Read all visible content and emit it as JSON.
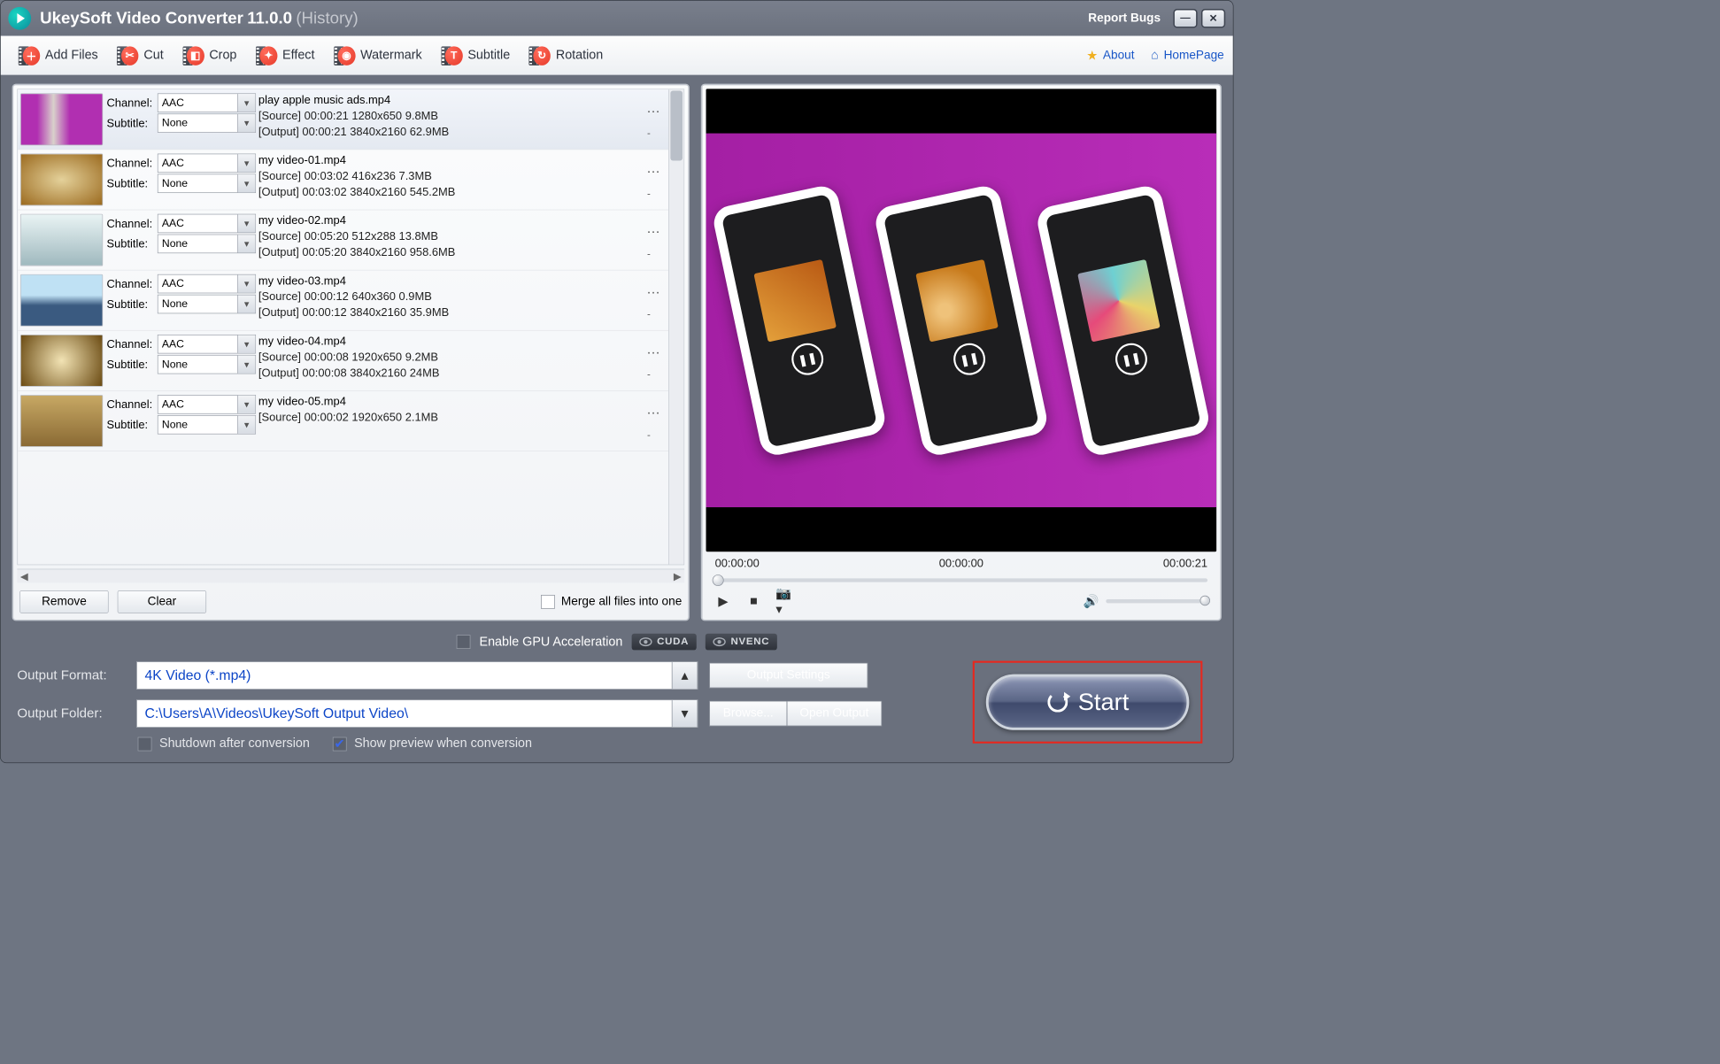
{
  "title": {
    "app": "UkeySoft Video Converter",
    "version": "11.0.0",
    "history": "(History)",
    "report": "Report Bugs"
  },
  "toolbar": {
    "add": "Add Files",
    "cut": "Cut",
    "crop": "Crop",
    "effect": "Effect",
    "watermark": "Watermark",
    "subtitle": "Subtitle",
    "rotation": "Rotation",
    "about": "About",
    "homepage": "HomePage"
  },
  "labels": {
    "channel": "Channel:",
    "subtitle": "Subtitle:",
    "merge": "Merge all files into one",
    "remove": "Remove",
    "clear": "Clear"
  },
  "items": [
    {
      "file": "play apple music ads.mp4",
      "channel": "AAC",
      "subtitle": "None",
      "src": "[Source]  00:00:21  1280x650  9.8MB",
      "out": "[Output]  00:00:21  3840x2160  62.9MB"
    },
    {
      "file": "my video-01.mp4",
      "channel": "AAC",
      "subtitle": "None",
      "src": "[Source]  00:03:02  416x236  7.3MB",
      "out": "[Output]  00:03:02  3840x2160  545.2MB"
    },
    {
      "file": "my video-02.mp4",
      "channel": "AAC",
      "subtitle": "None",
      "src": "[Source]  00:05:20  512x288  13.8MB",
      "out": "[Output]  00:05:20  3840x2160  958.6MB"
    },
    {
      "file": "my video-03.mp4",
      "channel": "AAC",
      "subtitle": "None",
      "src": "[Source]  00:00:12  640x360  0.9MB",
      "out": "[Output]  00:00:12  3840x2160  35.9MB"
    },
    {
      "file": "my video-04.mp4",
      "channel": "AAC",
      "subtitle": "None",
      "src": "[Source]  00:00:08  1920x650  9.2MB",
      "out": "[Output]  00:00:08  3840x2160  24MB"
    },
    {
      "file": "my video-05.mp4",
      "channel": "AAC",
      "subtitle": "None",
      "src": "[Source]  00:00:02  1920x650  2.1MB",
      "out": ""
    }
  ],
  "preview": {
    "t0": "00:00:00",
    "t1": "00:00:00",
    "t2": "00:00:21"
  },
  "gpu": {
    "label": "Enable GPU Acceleration",
    "cuda": "CUDA",
    "nvenc": "NVENC"
  },
  "output": {
    "formatLabel": "Output Format:",
    "format": "4K Video (*.mp4)",
    "folderLabel": "Output Folder:",
    "folder": "C:\\Users\\A\\Videos\\UkeySoft Output Video\\",
    "settings": "Output Settings",
    "browse": "Browse...",
    "open": "Open Output",
    "shutdown": "Shutdown after conversion",
    "showprev": "Show preview when conversion",
    "start": "Start"
  }
}
